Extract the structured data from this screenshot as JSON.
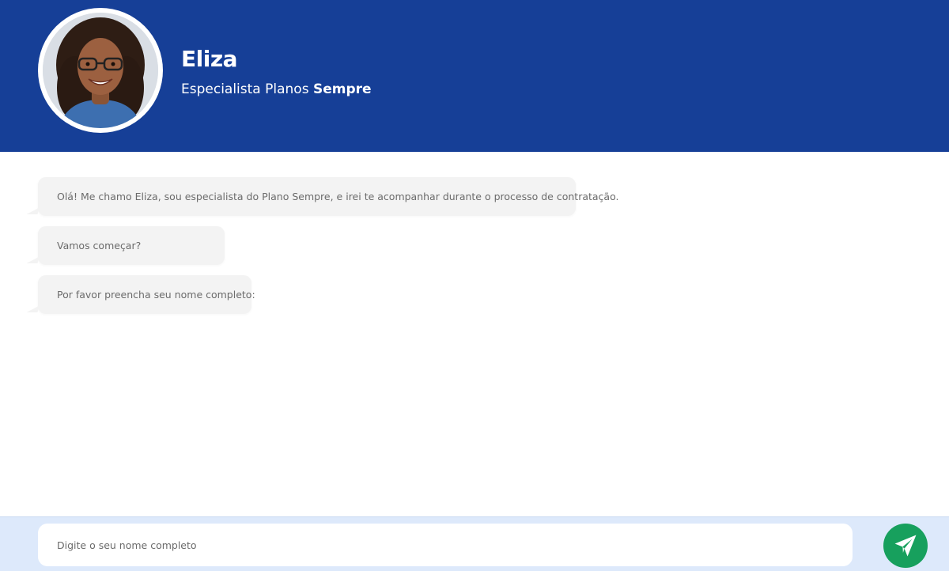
{
  "header": {
    "agent_name": "Eliza",
    "role_prefix": "Especialista Planos",
    "role_brand": "Sempre",
    "avatar_icon": "agent-photo"
  },
  "chat": {
    "messages": [
      {
        "text": "Olá! Me chamo Eliza, sou especialista do Plano Sempre, e irei te acompanhar durante o processo de contratação."
      },
      {
        "text": "Vamos começar?"
      },
      {
        "text": "Por favor preencha seu nome completo:"
      }
    ]
  },
  "composer": {
    "placeholder": "Digite o seu nome completo",
    "value": "",
    "send_icon": "paper-plane-icon"
  },
  "colors": {
    "header_bg": "#163f97",
    "bubble_bg": "#f3f3f3",
    "footer_bg": "#dde9fb",
    "send_button": "#17a05d"
  }
}
